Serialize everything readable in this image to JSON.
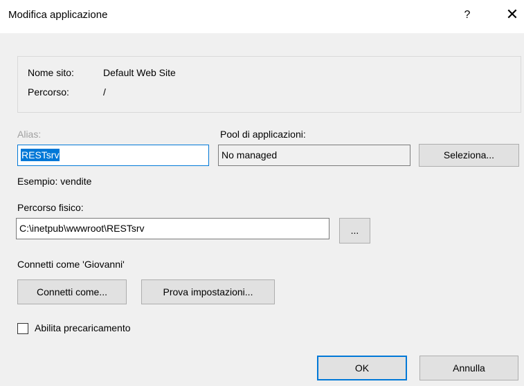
{
  "window": {
    "title": "Modifica applicazione",
    "help_glyph": "?",
    "close_glyph": "✕"
  },
  "site": {
    "name_label": "Nome sito:",
    "name_value": "Default Web Site",
    "path_label": "Percorso:",
    "path_value": "/"
  },
  "alias": {
    "label": "Alias:",
    "value": "RESTsrv",
    "example": "Esempio: vendite"
  },
  "pool": {
    "label": "Pool di applicazioni:",
    "value": "No managed",
    "select_label": "Seleziona..."
  },
  "physical_path": {
    "label": "Percorso fisico:",
    "value": "C:\\inetpub\\wwwroot\\RESTsrv",
    "browse_label": "..."
  },
  "connect": {
    "status": "Connetti come 'Giovanni'",
    "connect_as_label": "Connetti come...",
    "test_settings_label": "Prova impostazioni..."
  },
  "preload": {
    "label": "Abilita precaricamento",
    "checked": false
  },
  "footer": {
    "ok_label": "OK",
    "cancel_label": "Annulla"
  },
  "colors": {
    "accent": "#0078d7",
    "background": "#f0f0f0"
  }
}
